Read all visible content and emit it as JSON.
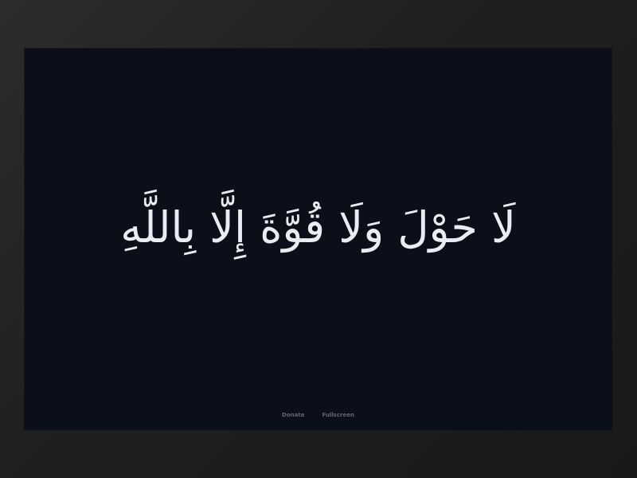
{
  "verse": {
    "text": "لَا حَوْلَ وَلَا قُوَّةَ إِلَّا بِاللَّهِ"
  },
  "footer": {
    "donate_label": "Donate",
    "fullscreen_label": "Fullscreen"
  },
  "colors": {
    "screen_background": "#0b0f19",
    "text": "#e9ecf3",
    "footer_text": "#5f6674"
  }
}
